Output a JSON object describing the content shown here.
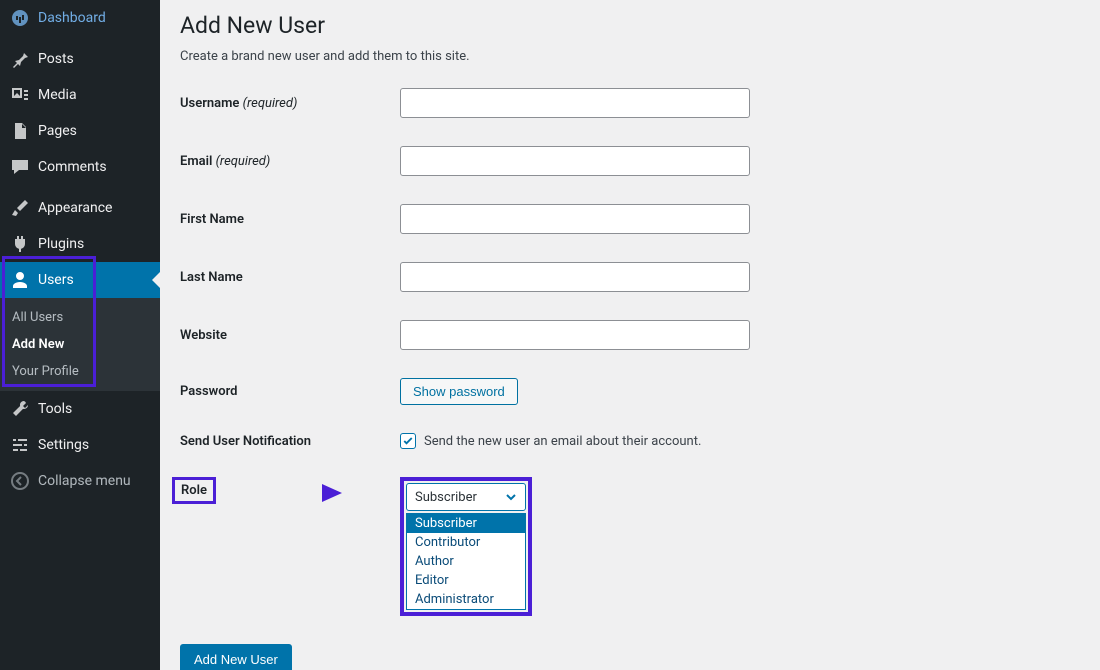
{
  "sidebar": {
    "items": [
      {
        "label": "Dashboard"
      },
      {
        "label": "Posts"
      },
      {
        "label": "Media"
      },
      {
        "label": "Pages"
      },
      {
        "label": "Comments"
      },
      {
        "label": "Appearance"
      },
      {
        "label": "Plugins"
      },
      {
        "label": "Users"
      },
      {
        "label": "Tools"
      },
      {
        "label": "Settings"
      }
    ],
    "submenu_users": [
      {
        "label": "All Users"
      },
      {
        "label": "Add New"
      },
      {
        "label": "Your Profile"
      }
    ],
    "collapse": "Collapse menu"
  },
  "page": {
    "title": "Add New User",
    "intro": "Create a brand new user and add them to this site."
  },
  "form": {
    "username_label": "Username",
    "email_label": "Email",
    "required_suffix": "(required)",
    "firstname_label": "First Name",
    "lastname_label": "Last Name",
    "website_label": "Website",
    "password_label": "Password",
    "show_password_btn": "Show password",
    "notify_label": "Send User Notification",
    "notify_desc": "Send the new user an email about their account.",
    "role_label": "Role",
    "role_selected": "Subscriber",
    "role_options": [
      "Subscriber",
      "Contributor",
      "Author",
      "Editor",
      "Administrator"
    ],
    "submit": "Add New User"
  }
}
